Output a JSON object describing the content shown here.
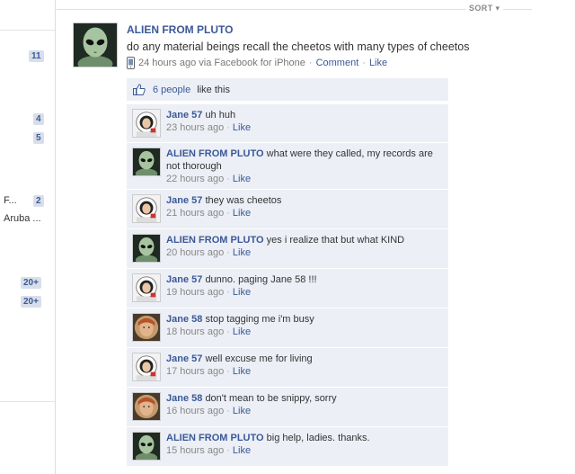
{
  "sort_label": "SORT",
  "left_counts": [
    "11",
    "4",
    "5",
    "2",
    "20+",
    "20+"
  ],
  "left_items": [
    "F...",
    "Aruba ..."
  ],
  "post": {
    "author": "ALIEN FROM PLUTO",
    "message": "do any material beings recall the cheetos with many types of cheetos",
    "time": "24 hours ago via Facebook for iPhone",
    "comment_label": "Comment",
    "like_label": "Like"
  },
  "likes": {
    "count_text": "6 people",
    "suffix": " like this"
  },
  "comments": [
    {
      "name": "Jane 57",
      "text": "uh huh",
      "time": "23 hours ago",
      "like": "Like",
      "avatar": "astronaut"
    },
    {
      "name": "ALIEN FROM PLUTO",
      "text": "what were they called, my records are not thorough",
      "time": "22 hours ago",
      "like": "Like",
      "avatar": "alien"
    },
    {
      "name": "Jane 57",
      "text": "they was cheetos",
      "time": "21 hours ago",
      "like": "Like",
      "avatar": "astronaut"
    },
    {
      "name": "ALIEN FROM PLUTO",
      "text": "yes i realize that but what KIND",
      "time": "20 hours ago",
      "like": "Like",
      "avatar": "alien"
    },
    {
      "name": "Jane 57",
      "text": "dunno. paging Jane 58 !!!",
      "time": "19 hours ago",
      "like": "Like",
      "avatar": "astronaut"
    },
    {
      "name": "Jane 58",
      "text": "stop tagging me i'm busy",
      "time": "18 hours ago",
      "like": "Like",
      "avatar": "face"
    },
    {
      "name": "Jane 57",
      "text": "well excuse me for living",
      "time": "17 hours ago",
      "like": "Like",
      "avatar": "astronaut"
    },
    {
      "name": "Jane 58",
      "text": "don't mean to be snippy, sorry",
      "time": "16 hours ago",
      "like": "Like",
      "avatar": "face"
    },
    {
      "name": "ALIEN FROM PLUTO",
      "text": "big help, ladies. thanks.",
      "time": "15 hours ago",
      "like": "Like",
      "avatar": "alien"
    }
  ]
}
